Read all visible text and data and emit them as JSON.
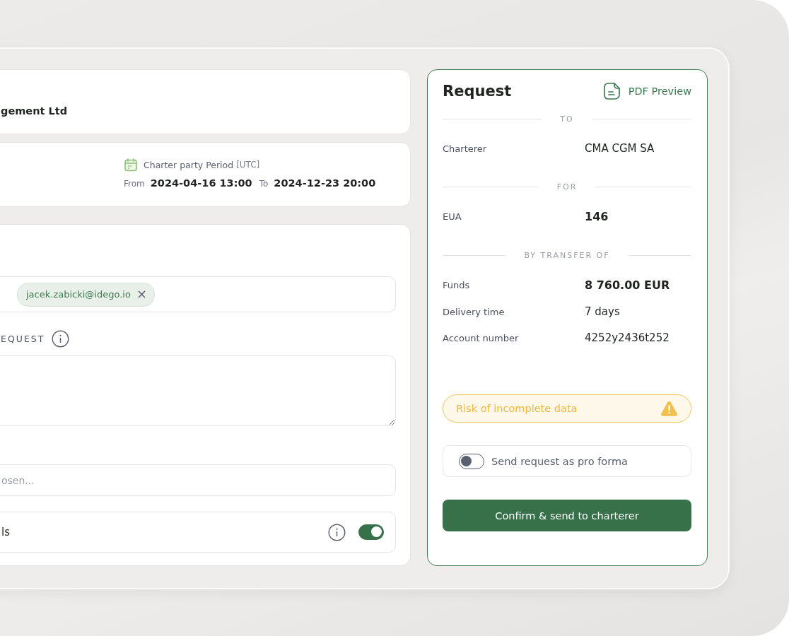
{
  "company": {
    "name": "gement Ltd"
  },
  "period": {
    "label": "Charter party Period",
    "unit": "[UTC]",
    "from_label": "From",
    "from": "2024-04-16 13:00",
    "to_label": "To",
    "to": "2024-12-23 20:00"
  },
  "form": {
    "recipients": [
      {
        "email": "jacek.zabicki@idego.io"
      }
    ],
    "message_label": "EQUEST",
    "select_placeholder": "osen...",
    "option": {
      "label": "ls",
      "on": true
    }
  },
  "request": {
    "title": "Request",
    "pdf_link": "PDF Preview",
    "sections": [
      {
        "heading": "TO",
        "rows": [
          {
            "label": "Charterer",
            "value": "CMA CGM SA",
            "bold": false
          }
        ]
      },
      {
        "heading": "FOR",
        "rows": [
          {
            "label": "EUA",
            "value": "146",
            "bold": true
          }
        ]
      },
      {
        "heading": "BY TRANSFER OF",
        "rows": [
          {
            "label": "Funds",
            "value": "8 760.00 EUR",
            "bold": true
          },
          {
            "label": "Delivery time",
            "value": "7 days",
            "bold": false
          },
          {
            "label": "Account number",
            "value": "4252y2436t252",
            "bold": false
          }
        ]
      }
    ],
    "warning": "Risk of incomplete data",
    "pro_forma": {
      "label": "Send request as pro forma",
      "on": false
    },
    "confirm": "Confirm & send to charterer"
  }
}
